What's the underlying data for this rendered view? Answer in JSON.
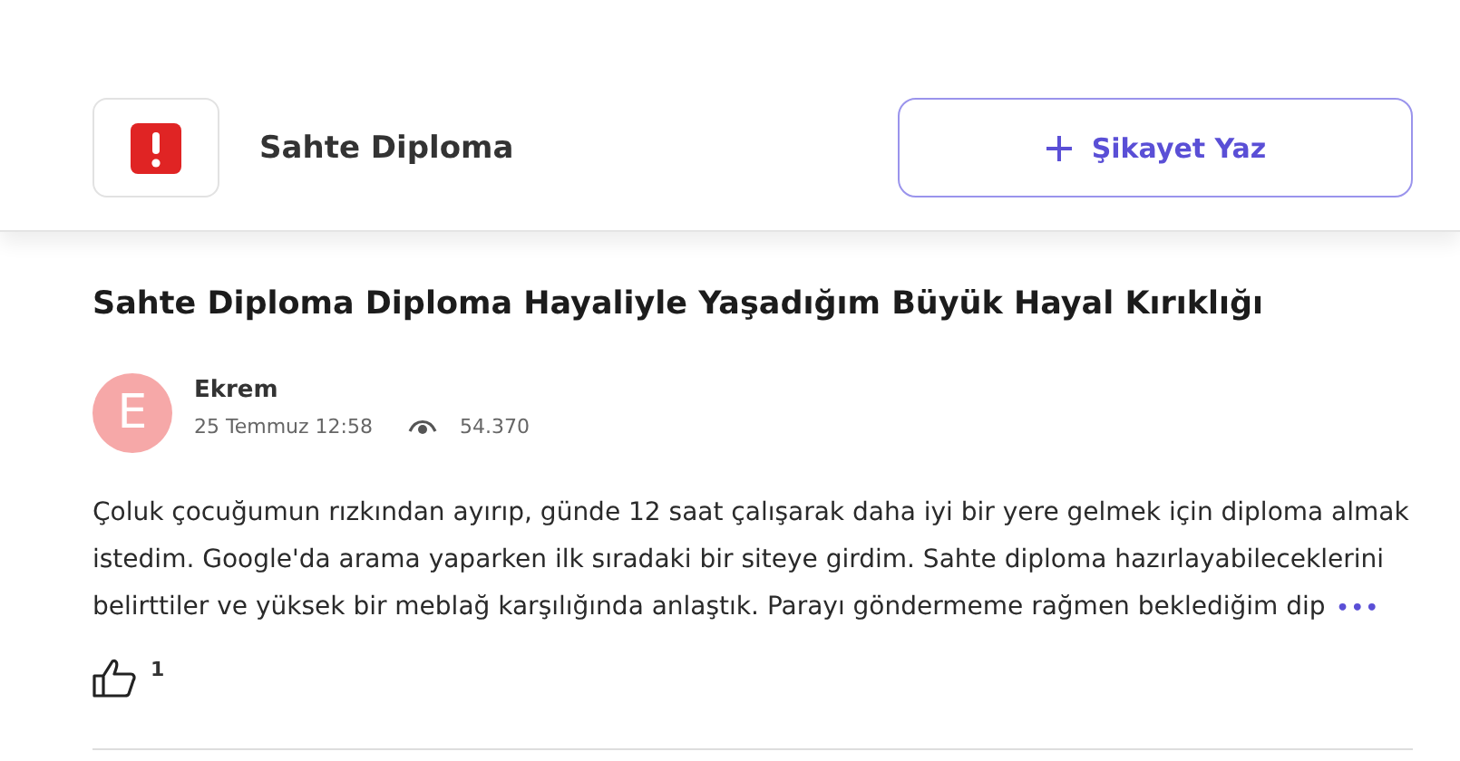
{
  "brand": {
    "name": "Sahte Diploma"
  },
  "action_button": {
    "label": "Şikayet Yaz"
  },
  "complaint": {
    "title": "Sahte Diploma Diploma Hayaliyle Yaşadığım Büyük Hayal Kırıklığı",
    "author": {
      "initial": "E",
      "name": "Ekrem",
      "date": "25 Temmuz 12:58",
      "views": "54.370"
    },
    "body": "Çoluk çocuğumun rızkından ayırıp, günde 12 saat çalışarak daha iyi bir yere gelmek için diploma almak istedim. Google'da arama yaparken ilk sıradaki bir siteye girdim. Sahte diploma hazırlayabileceklerini belirttiler ve yüksek bir meblağ karşılığında anlaştık. Parayı göndermeme rağmen beklediğim dip",
    "more": "•••",
    "likes": "1"
  }
}
